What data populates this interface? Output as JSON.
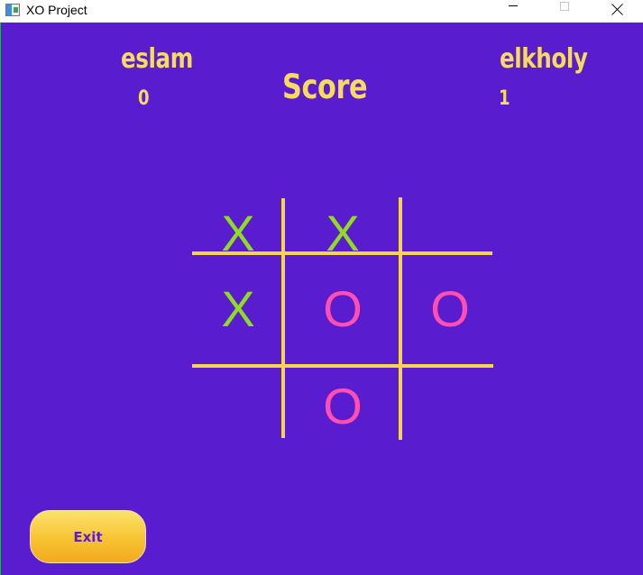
{
  "window": {
    "title": "XO Project",
    "icon": "app-window-icon",
    "controls": [
      "minimize-icon",
      "maximize-icon",
      "close-icon"
    ]
  },
  "scoreboard": {
    "title": "Score",
    "player1": {
      "name": "eslam",
      "score": "0"
    },
    "player2": {
      "name": "elkholy",
      "score": "1"
    }
  },
  "board": {
    "cells": [
      "X",
      "X",
      "",
      "X",
      "O",
      "O",
      "",
      "O",
      ""
    ]
  },
  "exit_button": {
    "label": "Exit"
  },
  "colors": {
    "background": "#5a1ccf",
    "text_yellow": "#f7db5e",
    "grid_line": "#f5d54a",
    "x_mark": "#8fdc22",
    "o_mark": "#ff4fb0",
    "button_gradient_top": "#fbe26a",
    "button_gradient_bottom": "#f2a91f"
  }
}
